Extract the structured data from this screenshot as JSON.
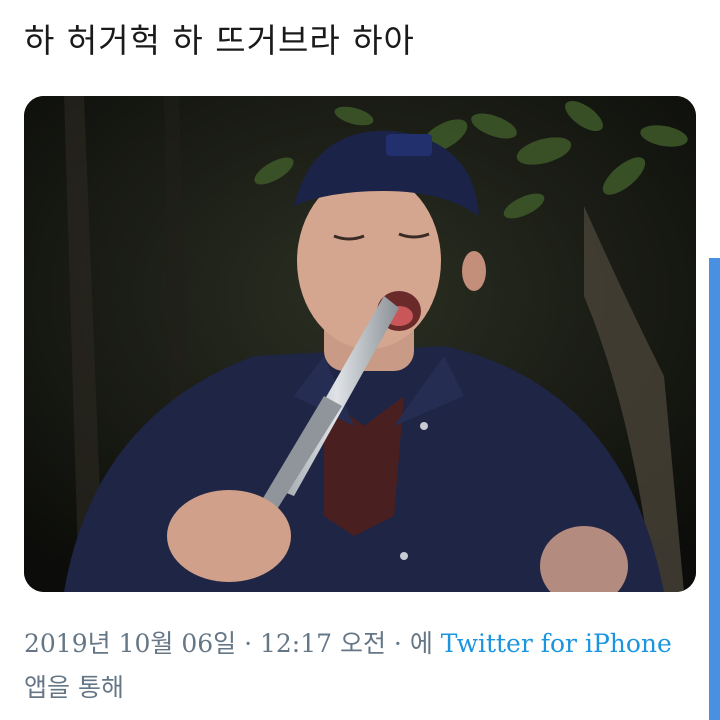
{
  "tweet": {
    "text": "하 허거헉 하 뜨거브라 하아"
  },
  "meta": {
    "timestamp": "2019년 10월 06일 · 12:17 오전 · 에",
    "source_link": "Twitter for iPhone",
    "suffix": "앱을 통해"
  },
  "colors": {
    "text": "#1a1a1a",
    "meta": "#657786",
    "link": "#1b95e0",
    "accent_bar": "#4a90e2"
  }
}
